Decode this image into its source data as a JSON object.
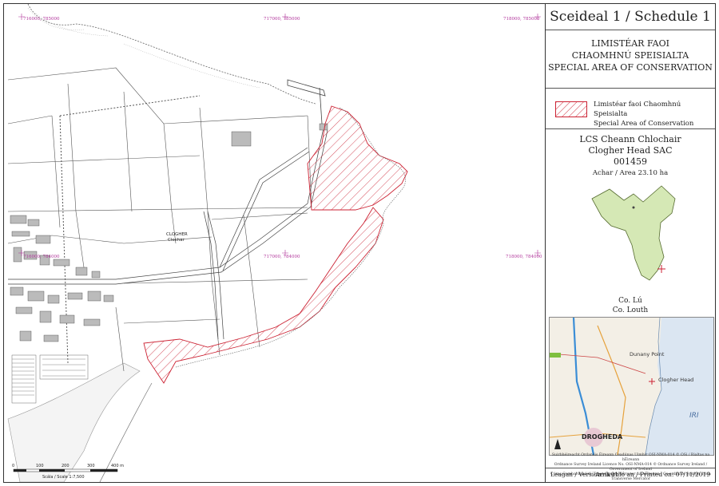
{
  "map": {
    "grid_labels": {
      "top_left": "716000, 785000",
      "top_mid": "717000, 785000",
      "top_right": "718000, 785000",
      "mid_left": "716000, 784000",
      "mid_mid": "717000, 784000",
      "mid_right": "718000, 784000"
    },
    "place_label_en": "CLOGHER",
    "place_label_ga": "Clochar",
    "scale_bar": {
      "ticks": [
        "0",
        "100",
        "200",
        "300",
        "400 m"
      ],
      "label": "Scála / Scale 1:7,500"
    },
    "sac_hatch_color": "#cc2233"
  },
  "panel": {
    "title": "Sceideal 1 / Schedule 1",
    "designation_ga_1": "LIMISTÉAR FAOI",
    "designation_ga_2": "CHAOMHNÚ SPEISIALTA",
    "designation_en": "SPECIAL AREA OF CONSERVATION",
    "legend_ga": "Limistéar faoi Chaomhnú Speisialta",
    "legend_en": "Special Area of Conservation",
    "site_name_ga": "LCS Cheann Chlochair",
    "site_name_en": "Clogher Head SAC",
    "site_code": "001459",
    "area": "Achar / Area 23.10 ha",
    "county_ga": "Co. Lú",
    "county_en": "Co. Louth",
    "county_fill": "#d5e8b5",
    "location_map": {
      "labels": [
        "Dunany Point",
        "Clogher Head",
        "DROGHEDA",
        "IRI"
      ],
      "sea_color": "#dbe6f2"
    },
    "copyright_lines": [
      "Suirbhéireacht Ordanáis Éireann Ceadúnas Uimhir OSI-NMA-014 © OSi / Rialtas na hÉireann",
      "Ordnance Survey Ireland Licence No. OSI-NMA-014 © Ordnance Survey Ireland / Government of Ireland",
      "Córas Comhordanáidí: Trasteilgean Mercator na hÉireann / Co-ordinate System: Irish Transverse Mercator"
    ],
    "version": "Leagan / Version: 3.01",
    "printed": "Arna chló an / Printed on: 07/11/2019"
  }
}
